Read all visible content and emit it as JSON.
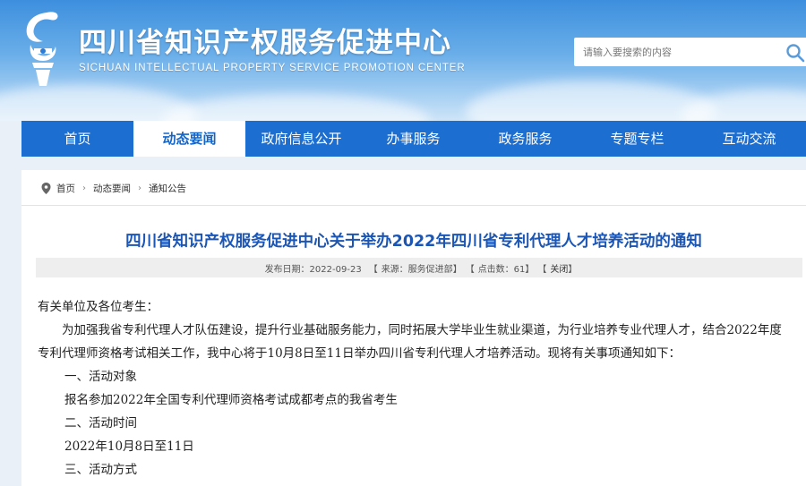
{
  "header": {
    "title": "四川省知识产权服务促进中心",
    "subtitle": "SICHUAN INTELLECTUAL PROPERTY SERVICE PROMOTION CENTER",
    "logo_icon": "sichuan-ip-logo-icon",
    "search_placeholder": "请输入要搜索的内容",
    "search_icon": "search-icon"
  },
  "nav": {
    "items": [
      {
        "label": "首页"
      },
      {
        "label": "动态要闻"
      },
      {
        "label": "政府信息公开"
      },
      {
        "label": "办事服务"
      },
      {
        "label": "政务服务"
      },
      {
        "label": "专题专栏"
      },
      {
        "label": "互动交流"
      }
    ],
    "active_index": 1
  },
  "breadcrumb": {
    "items": [
      "首页",
      "动态要闻",
      "通知公告"
    ],
    "separator": "›"
  },
  "article": {
    "title": "四川省知识产权服务促进中心关于举办2022年四川省专利代理人才培养活动的通知",
    "meta": {
      "date": "发布日期：2022-09-23",
      "source": "来源：服务促进部",
      "clicks": "点击数：61",
      "close": "关闭"
    },
    "paragraphs": [
      "有关单位及各位考生：",
      "为加强我省专利代理人才队伍建设，提升行业基础服务能力，同时拓展大学毕业生就业渠道，为行业培养专业代理人才，结合2022年度专利代理师资格考试相关工作，我中心将于10月8日至11日举办四川省专利代理人才培养活动。现将有关事项通知如下：",
      "一、活动对象",
      "报名参加2022年全国专利代理师资格考试成都考点的我省考生",
      "二、活动时间",
      "2022年10月8日至11日",
      "三、活动方式"
    ]
  },
  "colors": {
    "nav_bg": "#1c6fd1",
    "title_blue": "#1b56b5",
    "header_top": "#3d8fde"
  }
}
